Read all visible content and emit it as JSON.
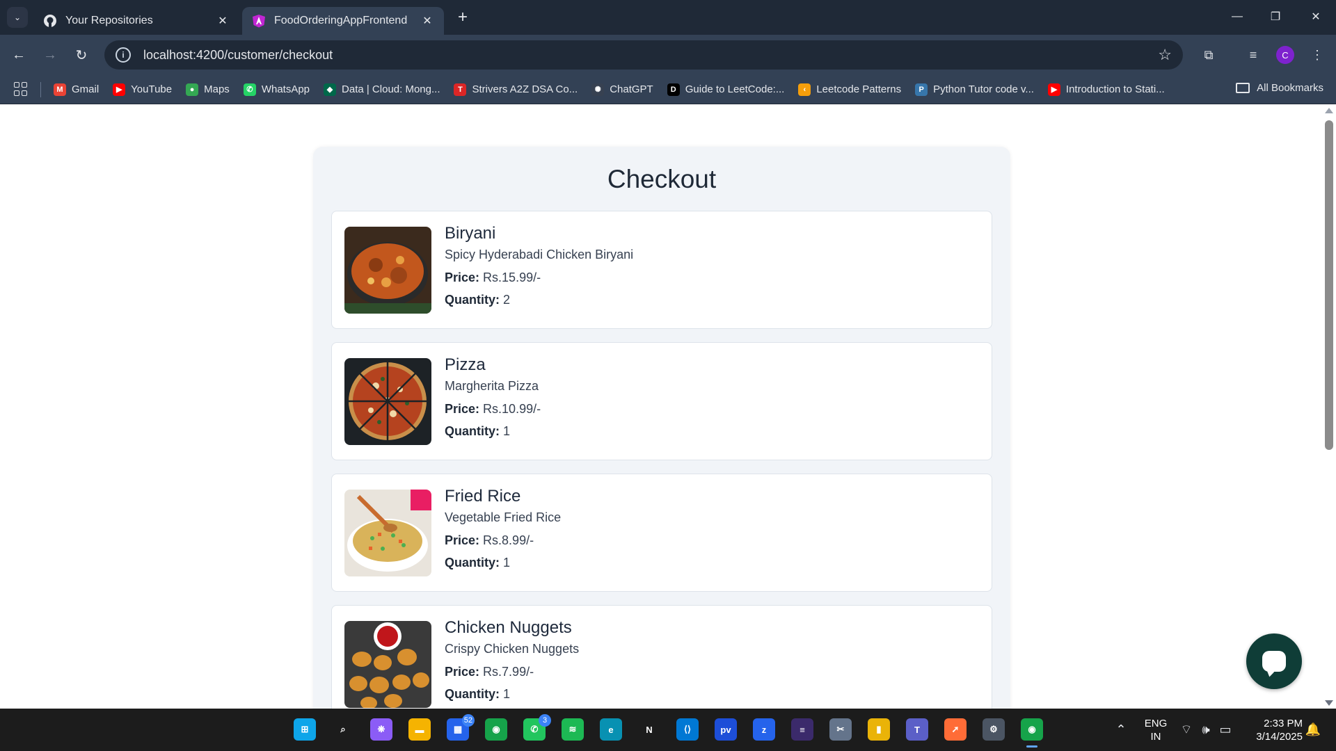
{
  "browser": {
    "tabs": [
      {
        "title": "Your Repositories",
        "icon": "github-icon",
        "active": false
      },
      {
        "title": "FoodOrderingAppFrontend",
        "icon": "angular-icon",
        "active": true
      }
    ],
    "url": "localhost:4200/customer/checkout",
    "profile_initial": "C",
    "bookmarks": [
      {
        "label": "Gmail",
        "icon": "gmail-icon",
        "color": "#ea4335",
        "glyph": "M"
      },
      {
        "label": "YouTube",
        "icon": "youtube-icon",
        "color": "#ff0000",
        "glyph": "▶"
      },
      {
        "label": "Maps",
        "icon": "maps-icon",
        "color": "#34a853",
        "glyph": "●"
      },
      {
        "label": "WhatsApp",
        "icon": "whatsapp-icon",
        "color": "#25d366",
        "glyph": "✆"
      },
      {
        "label": "Data | Cloud: Mong...",
        "icon": "mongodb-icon",
        "color": "#00684a",
        "glyph": "◆"
      },
      {
        "label": "Strivers A2Z DSA Co...",
        "icon": "tuf-icon",
        "color": "#dc2626",
        "glyph": "T"
      },
      {
        "label": "ChatGPT",
        "icon": "chatgpt-icon",
        "color": "#374151",
        "glyph": "✺"
      },
      {
        "label": "Guide to LeetCode:...",
        "icon": "dev-icon",
        "color": "#000000",
        "glyph": "D"
      },
      {
        "label": "Leetcode Patterns",
        "icon": "leetcode-icon",
        "color": "#f59e0b",
        "glyph": "‹"
      },
      {
        "label": "Python Tutor code v...",
        "icon": "python-icon",
        "color": "#3776ab",
        "glyph": "P"
      },
      {
        "label": "Introduction to Stati...",
        "icon": "youtube-icon",
        "color": "#ff0000",
        "glyph": "▶"
      }
    ],
    "all_bookmarks": "All Bookmarks"
  },
  "checkout": {
    "title": "Checkout",
    "price_label": "Price:",
    "quantity_label": "Quantity:",
    "items": [
      {
        "name": "Biryani",
        "description": "Spicy Hyderabadi Chicken Biryani",
        "price": "Rs.15.99/-",
        "quantity": "2",
        "image": "biryani"
      },
      {
        "name": "Pizza",
        "description": "Margherita Pizza",
        "price": "Rs.10.99/-",
        "quantity": "1",
        "image": "pizza"
      },
      {
        "name": "Fried Rice",
        "description": "Vegetable Fried Rice",
        "price": "Rs.8.99/-",
        "quantity": "1",
        "image": "fried-rice"
      },
      {
        "name": "Chicken Nuggets",
        "description": "Crispy Chicken Nuggets",
        "price": "Rs.7.99/-",
        "quantity": "1",
        "image": "nuggets"
      }
    ]
  },
  "taskbar": {
    "apps": [
      {
        "name": "start-icon",
        "color": "#0ea5e9",
        "glyph": "⊞"
      },
      {
        "name": "search-icon",
        "color": "transparent",
        "glyph": "⌕"
      },
      {
        "name": "copilot-icon",
        "color": "#8b5cf6",
        "glyph": "❋"
      },
      {
        "name": "file-explorer-icon",
        "color": "#f5b301",
        "glyph": "▬"
      },
      {
        "name": "store-icon",
        "color": "#2563eb",
        "glyph": "▦",
        "badge": "52"
      },
      {
        "name": "chrome-icon",
        "color": "#16a34a",
        "glyph": "◉"
      },
      {
        "name": "whatsapp-icon",
        "color": "#22c55e",
        "glyph": "✆",
        "badge": "3"
      },
      {
        "name": "spotify-icon",
        "color": "#1db954",
        "glyph": "≋"
      },
      {
        "name": "edge-icon",
        "color": "#0891b2",
        "glyph": "e"
      },
      {
        "name": "netflix-icon",
        "color": "transparent",
        "glyph": "N"
      },
      {
        "name": "vscode-icon",
        "color": "#0078d4",
        "glyph": "⟨⟩"
      },
      {
        "name": "prime-video-icon",
        "color": "#1d4ed8",
        "glyph": "pv"
      },
      {
        "name": "zoom-icon",
        "color": "#2563eb",
        "glyph": "z"
      },
      {
        "name": "eclipse-icon",
        "color": "#3b2a6b",
        "glyph": "≡"
      },
      {
        "name": "snipping-tool-icon",
        "color": "#64748b",
        "glyph": "✂"
      },
      {
        "name": "power-bi-icon",
        "color": "#eab308",
        "glyph": "▮"
      },
      {
        "name": "teams-icon",
        "color": "#5b5fc7",
        "glyph": "T"
      },
      {
        "name": "postman-icon",
        "color": "#ff6c37",
        "glyph": "➚"
      },
      {
        "name": "settings-icon",
        "color": "#4b5563",
        "glyph": "⚙"
      },
      {
        "name": "chrome-profile-icon",
        "color": "#16a34a",
        "glyph": "◉",
        "active": true
      }
    ],
    "language": "ENG",
    "region": "IN",
    "time": "2:33 PM",
    "date": "3/14/2025"
  }
}
